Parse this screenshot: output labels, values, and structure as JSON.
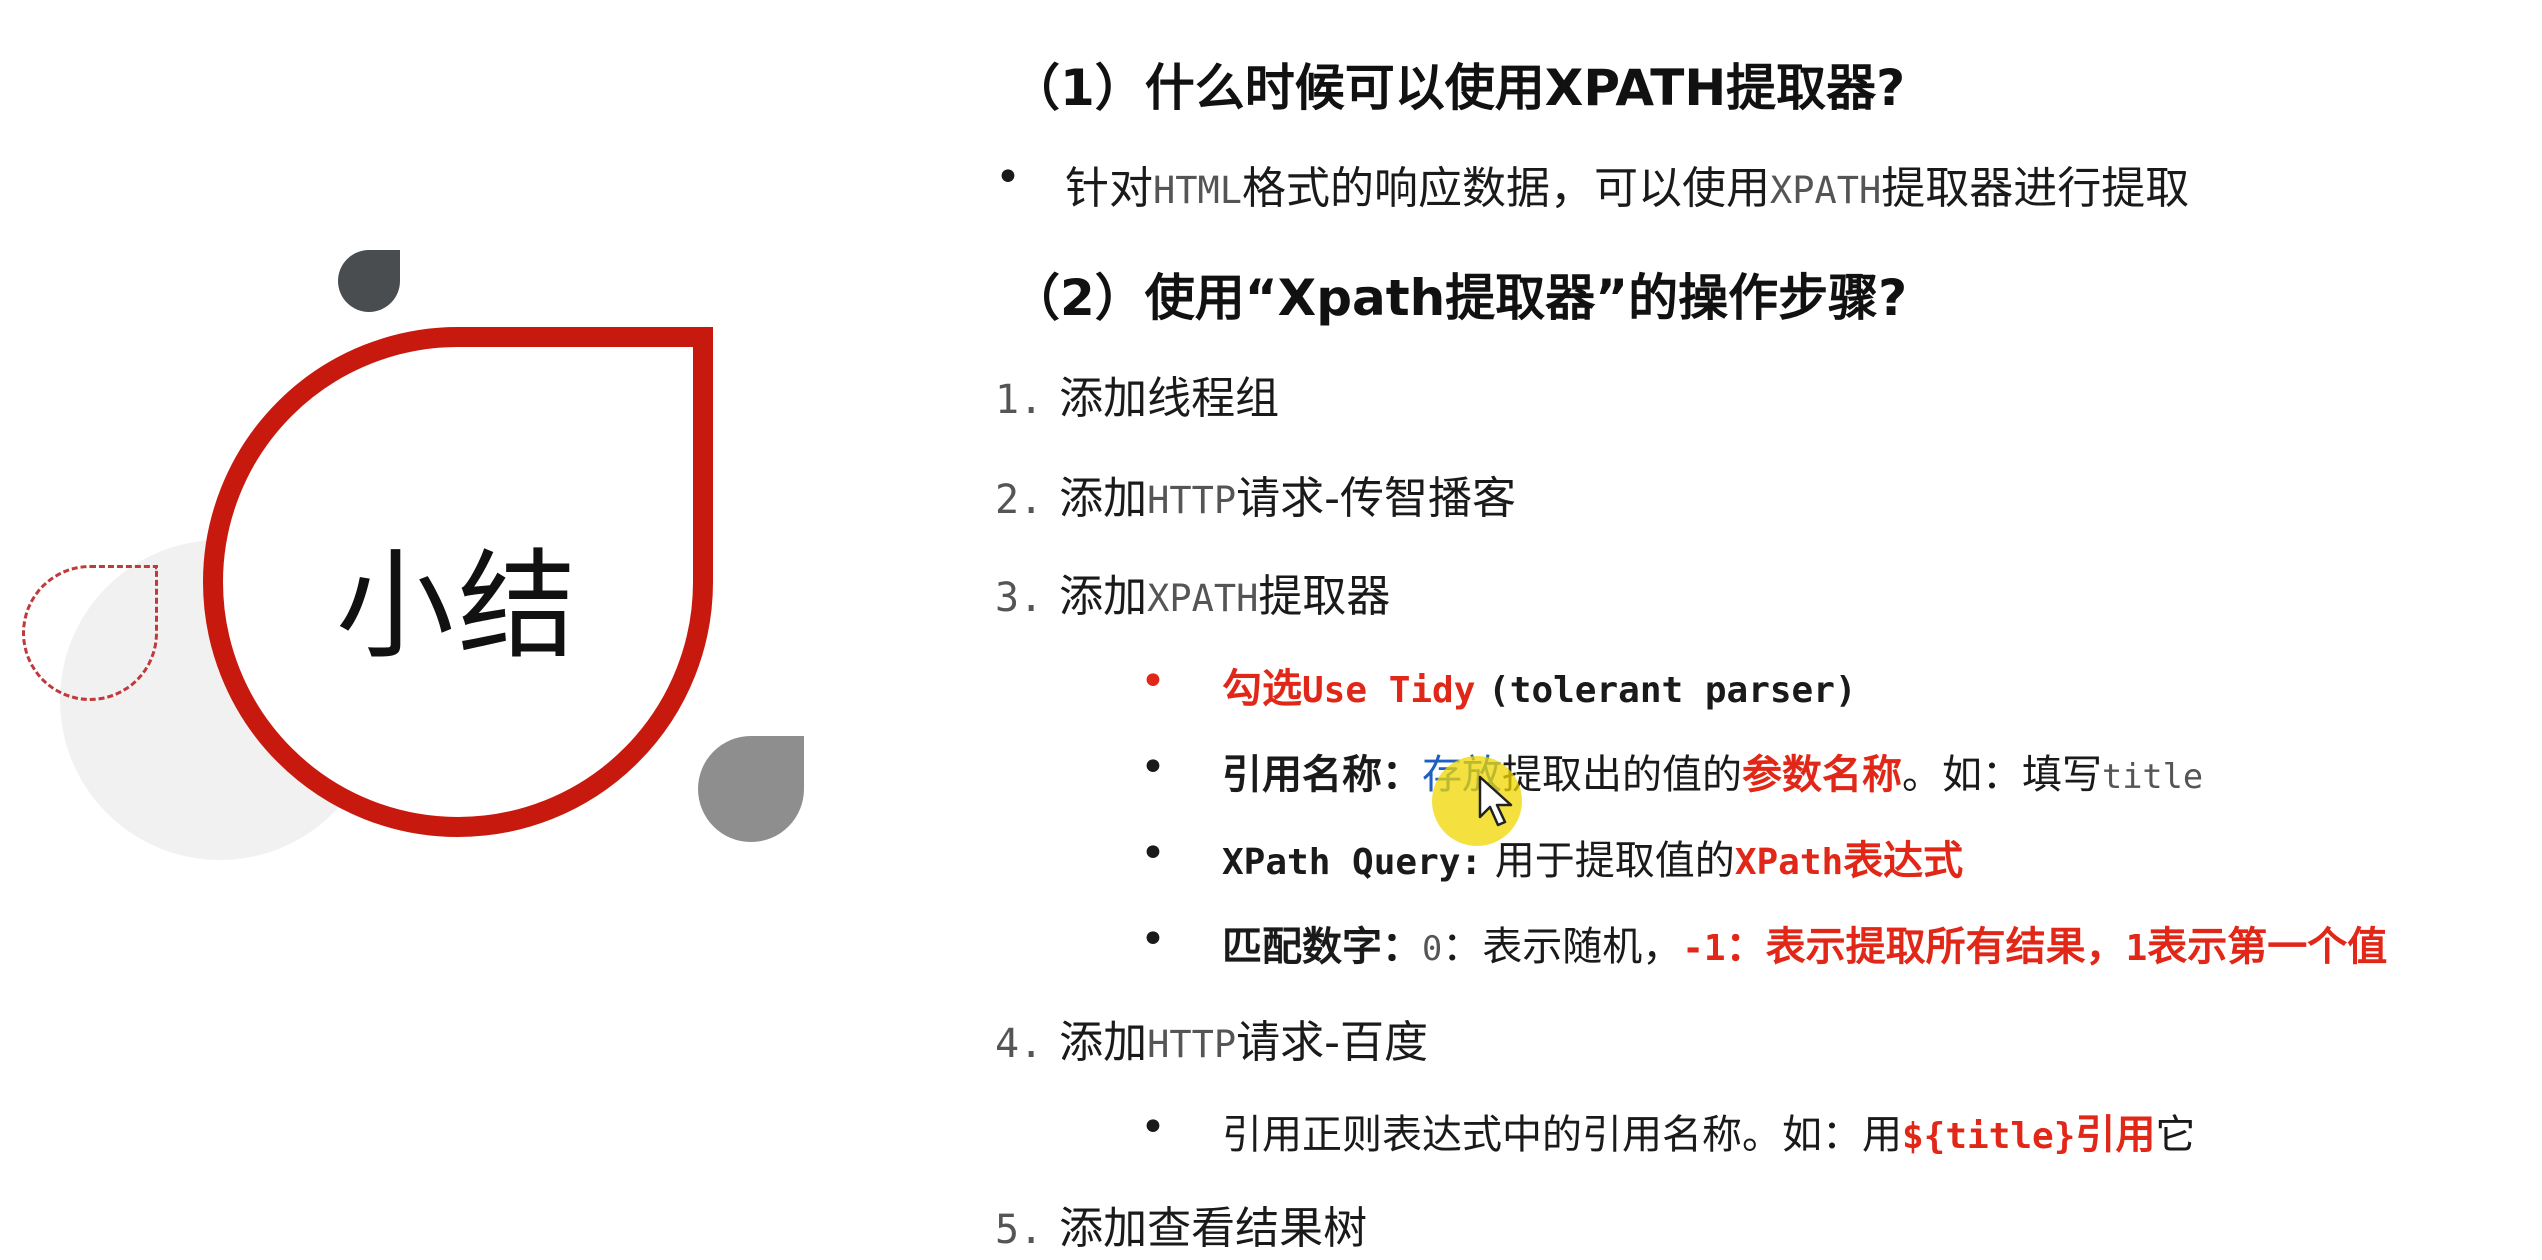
{
  "slide": {
    "summary_title": "小结",
    "q1_heading": "（1）什么时候可以使用XPATH提取器?",
    "q1_bullet": {
      "a": "针对",
      "b": "HTML",
      "c": "格式的响应数据，可以使用",
      "d": "XPATH",
      "e": "提取器进行提取"
    },
    "q2_heading": "（2）使用“Xpath提取器”的操作步骤?",
    "steps": [
      {
        "num": "1.",
        "text": "添加线程组"
      },
      {
        "num": "2.",
        "pre": "添加",
        "mono": "HTTP",
        "post": "请求-传智播客"
      },
      {
        "num": "3.",
        "pre": "添加",
        "mono": "XPATH",
        "post": "提取器"
      },
      {
        "num": "4.",
        "pre": "添加",
        "mono": "HTTP",
        "post": "请求-百度"
      },
      {
        "num": "5.",
        "text": "添加查看结果树"
      }
    ],
    "sub3": {
      "tidy": {
        "a": "勾选",
        "b": "Use Tidy",
        "c": "(tolerant parser)"
      },
      "ref": {
        "a": "引用名称：",
        "b": "存放",
        "c": "提取出的值的",
        "d": "参数名称",
        "e": "。如：填写",
        "f": "title"
      },
      "xq": {
        "a": "XPath Query:",
        "b": " 用于提取值的",
        "c": "XPath",
        "d": "表达式"
      },
      "match": {
        "a": "匹配数字：",
        "b": "0",
        "c": "：表示随机，",
        "d": "-1",
        "e": "：表示提取所有结果，",
        "f": "1",
        "g": "表示第一个值"
      }
    },
    "sub4": {
      "a": "引用正则表达式中的引用名称。如：用",
      "b": "${title}",
      "c": "引用",
      "d": "它"
    }
  },
  "colors": {
    "accent_red": "#c8190e",
    "text_red": "#e02718",
    "highlight": "#f0d700"
  },
  "icons": {
    "cursor": "mouse-pointer-icon"
  }
}
